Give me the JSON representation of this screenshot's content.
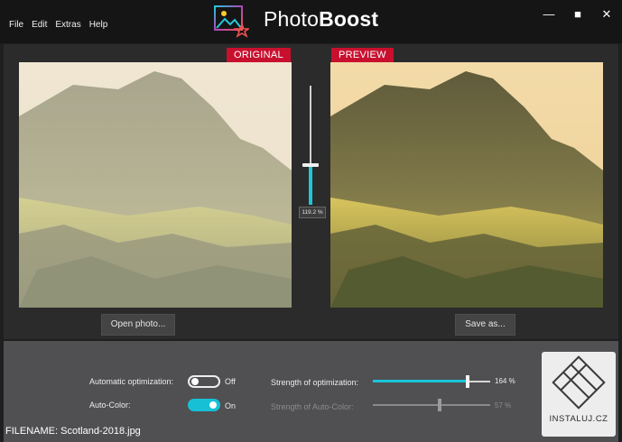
{
  "menu": [
    "File",
    "Edit",
    "Extras",
    "Help"
  ],
  "app": {
    "title_light": "Photo",
    "title_bold": "Boost"
  },
  "window_controls": {
    "minimize": "—",
    "maximize": "■",
    "close": "✕"
  },
  "panels": {
    "original_label": "ORIGINAL",
    "preview_label": "PREVIEW",
    "open_button": "Open photo...",
    "save_button": "Save as..."
  },
  "zoom": {
    "label": "119.2 %",
    "value_fraction": 0.33
  },
  "settings": {
    "auto_opt": {
      "label": "Automatic optimization:",
      "state": "Off"
    },
    "auto_color": {
      "label": "Auto-Color:",
      "state": "On"
    },
    "strength_opt": {
      "label": "Strength of optimization:",
      "value": "164 %",
      "fraction": 0.81
    },
    "strength_color": {
      "label": "Strength of Auto-Color:",
      "value": "57 %",
      "fraction": 0.57
    }
  },
  "filename": "FILENAME: Scotland-2018.jpg",
  "watermark": "INSTALUJ.CZ",
  "colors": {
    "accent": "#18c0d6",
    "tag": "#c8102e"
  }
}
